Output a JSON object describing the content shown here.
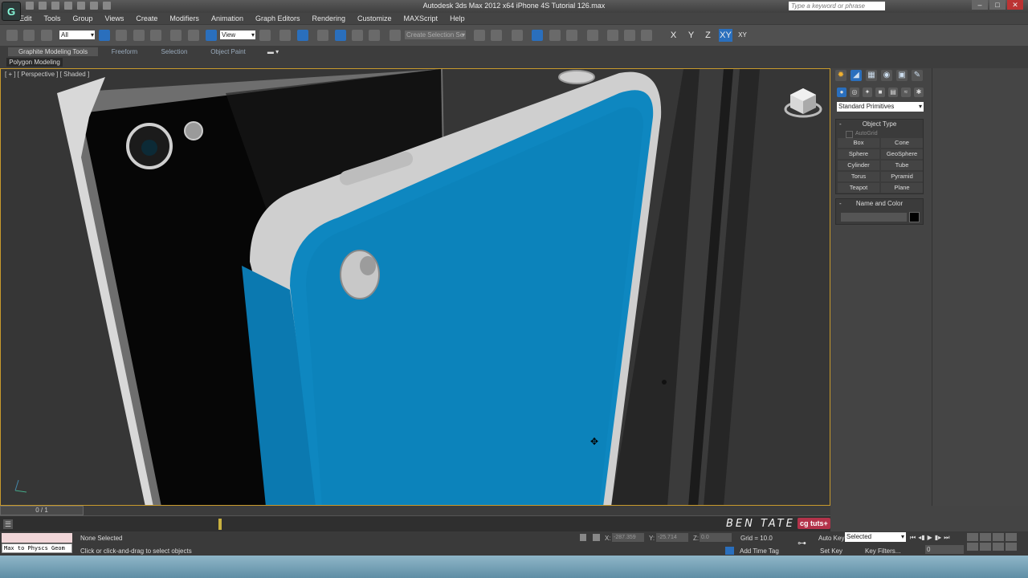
{
  "window": {
    "title": "Autodesk 3ds Max  2012 x64      iPhone 4S Tutorial 126.max",
    "app_logo": "3ds-max-logo-icon",
    "help_search_placeholder": "Type a keyword or phrase",
    "controls": {
      "minimize": "–",
      "maximize": "□",
      "close": "✕"
    }
  },
  "menu": {
    "items": [
      "Edit",
      "Tools",
      "Group",
      "Views",
      "Create",
      "Modifiers",
      "Animation",
      "Graph Editors",
      "Rendering",
      "Customize",
      "MAXScript",
      "Help"
    ]
  },
  "toolbar": {
    "selection_filter": "All",
    "ref_coord": "View",
    "named_selection_set": "Create Selection Se",
    "axis_constraints": [
      "X",
      "Y",
      "Z",
      "XY",
      "XY"
    ],
    "accent_color": "#2a6fbd"
  },
  "ribbon": {
    "tabs": [
      "Graphite Modeling Tools",
      "Freeform",
      "Selection",
      "Object Paint"
    ],
    "panel": "Polygon Modeling"
  },
  "viewport": {
    "label": "[ + ] [ Perspective ] [ Shaded ]",
    "phone_color": "#0c7fb6",
    "border_color": "#c89a2c"
  },
  "command_panel": {
    "category_dropdown": "Standard Primitives",
    "object_type": {
      "title": "Object Type",
      "autogrid": "AutoGrid",
      "buttons": [
        "Box",
        "Cone",
        "Sphere",
        "GeoSphere",
        "Cylinder",
        "Tube",
        "Torus",
        "Pyramid",
        "Teapot",
        "Plane"
      ]
    },
    "name_and_color": {
      "title": "Name and Color"
    }
  },
  "timeline": {
    "frame_label": "0 / 1"
  },
  "status": {
    "maxscript_listener": "Max to Physcs Geom",
    "selection": "None Selected",
    "prompt": "Click or click-and-drag to select objects",
    "x_label": "X:",
    "x_value": "-287.359",
    "y_label": "Y:",
    "y_value": "-25.714",
    "z_label": "Z:",
    "z_value": "0.0",
    "grid": "Grid = 10.0",
    "add_time_tag": "Add Time Tag",
    "auto_key": "Auto Key",
    "set_key": "Set Key",
    "key_mode": "Selected",
    "key_filters": "Key Filters...",
    "current_frame": "0"
  },
  "watermark": {
    "author": "BEN TATE",
    "brand": "cg tuts+"
  }
}
